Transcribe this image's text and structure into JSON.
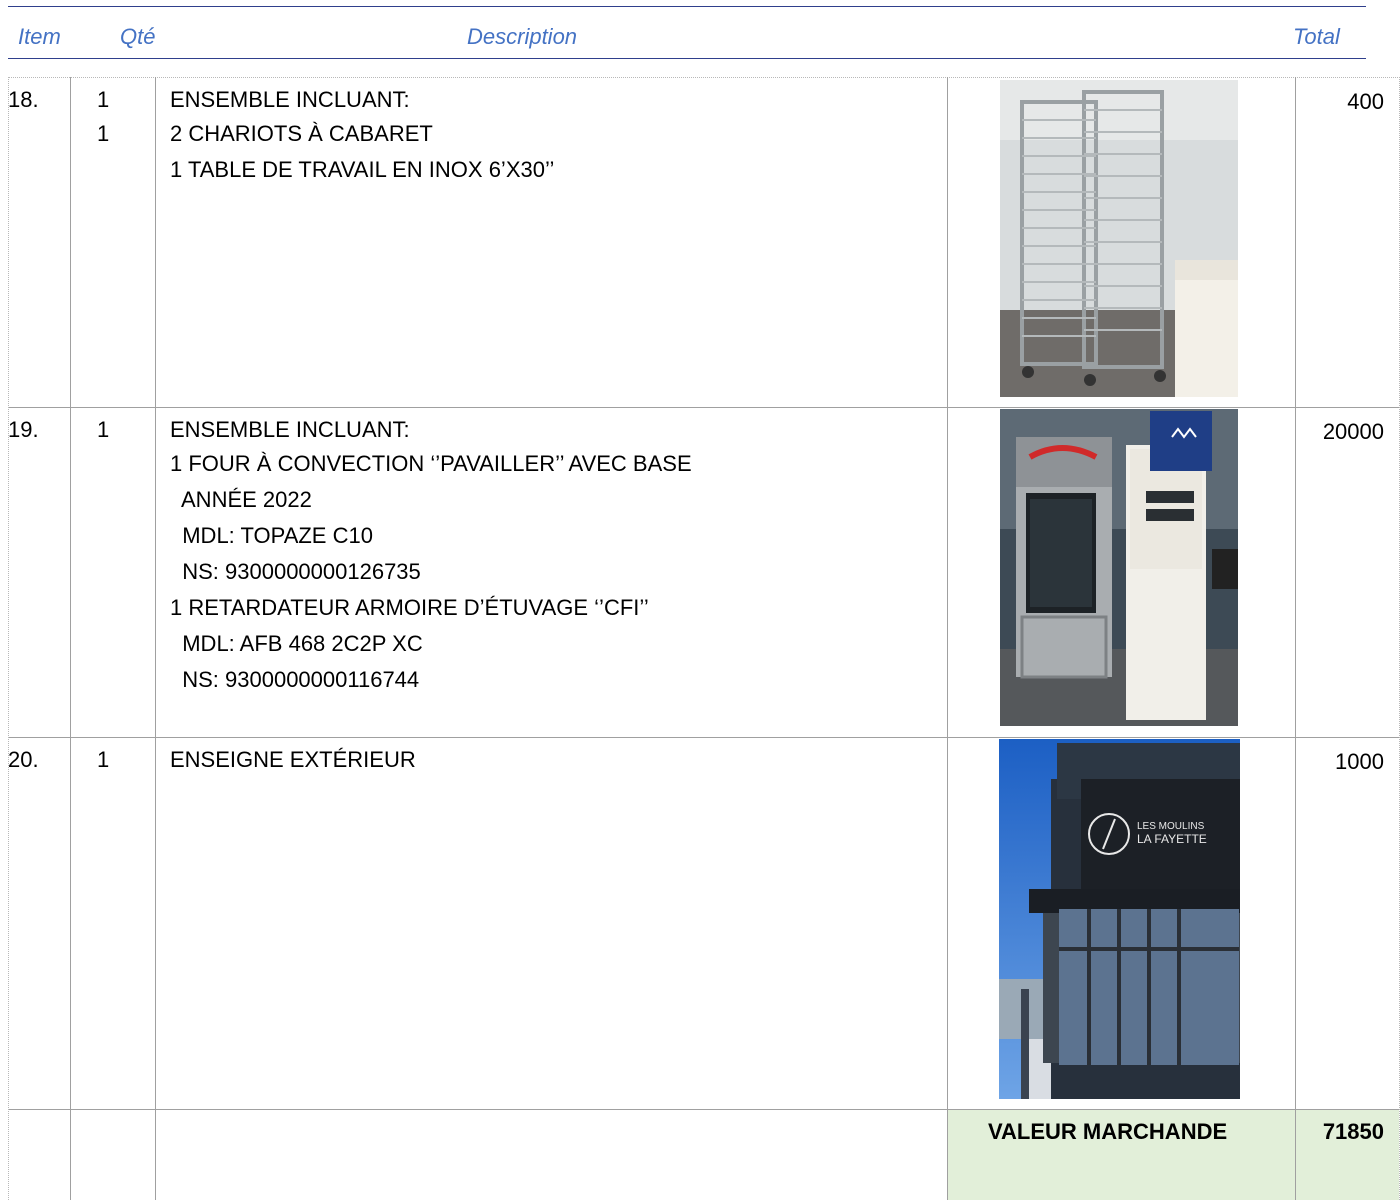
{
  "header": {
    "item": "Item",
    "qty": "Qté",
    "description": "Description",
    "total": "Total"
  },
  "rows": [
    {
      "item": "18.",
      "qty": [
        "1",
        "1"
      ],
      "lines": [
        "ENSEMBLE INCLUANT:",
        "2 CHARIOTS À CABARET",
        "1 TABLE DE TRAVAIL EN INOX 6’X30’’"
      ],
      "total": "400",
      "photo": "bakery-rack-carts-photo"
    },
    {
      "item": "19.",
      "qty": [
        "1"
      ],
      "lines": [
        "ENSEMBLE INCLUANT:",
        "1 FOUR À CONVECTION ‘’PAVAILLER’’ AVEC BASE",
        "  ANNÉE 2022",
        "  MDL: TOPAZE C10",
        "  NS: 9300000000126735",
        "1 RETARDATEUR ARMOIRE D’ÉTUVAGE ‘’CFI’’",
        "  MDL: AFB 468 2C2P XC",
        "  NS: 9300000000116744"
      ],
      "total": "20000",
      "photo": "convection-oven-proofer-photo"
    },
    {
      "item": "20.",
      "qty": [
        "1"
      ],
      "lines": [
        "ENSEIGNE EXTÉRIEUR"
      ],
      "total": "1000",
      "photo": "storefront-sign-photo",
      "sign_text": [
        "LES MOULINS",
        "LA FAYETTE"
      ]
    }
  ],
  "summary": {
    "label": "VALEUR MARCHANDE",
    "total": "71850"
  },
  "colors": {
    "header_text": "#4472c4",
    "header_rule": "#2f3f8c",
    "summary_bg": "#e2efd9"
  }
}
